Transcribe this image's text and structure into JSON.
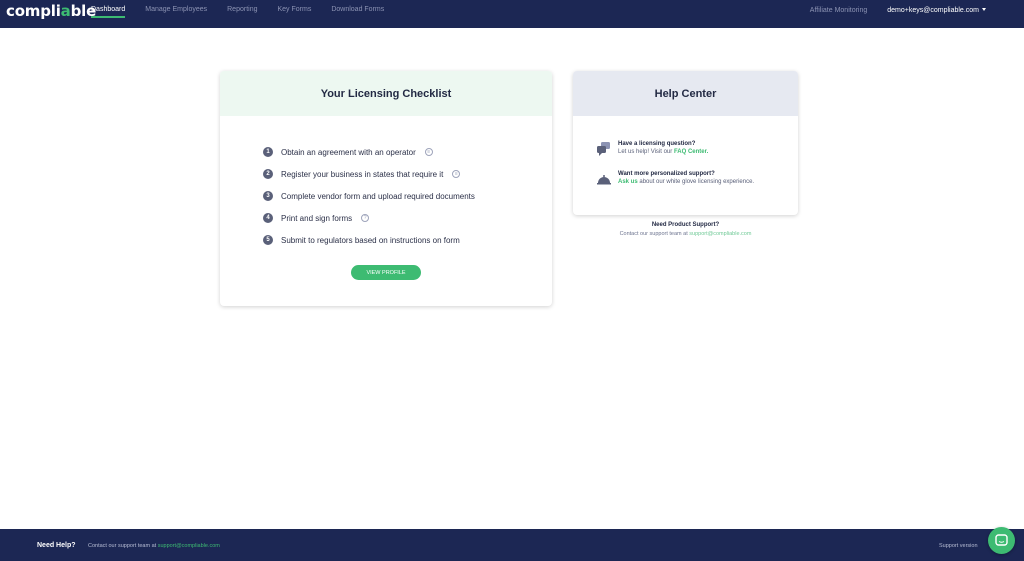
{
  "brand": {
    "name_prefix": "compli",
    "name_accent": "a",
    "name_suffix": "ble",
    "accent_color": "#3dbb72",
    "nav_color": "#1c2754"
  },
  "nav": {
    "items": [
      {
        "label": "Dashboard",
        "active": true
      },
      {
        "label": "Manage Employees",
        "active": false
      },
      {
        "label": "Reporting",
        "active": false
      },
      {
        "label": "Key Forms",
        "active": false
      },
      {
        "label": "Download Forms",
        "active": false
      }
    ],
    "affiliate": "Affiliate Monitoring",
    "user": "demo+keys@compliable.com"
  },
  "checklist": {
    "title": "Your Licensing Checklist",
    "items": [
      {
        "num": "1",
        "text": "Obtain an agreement with an operator",
        "icon": "chat-icon"
      },
      {
        "num": "2",
        "text": "Register your business in states that require it",
        "icon": "chat-icon"
      },
      {
        "num": "3",
        "text": "Complete vendor form and upload required documents",
        "icon": ""
      },
      {
        "num": "4",
        "text": "Print and sign forms",
        "icon": "help-icon"
      },
      {
        "num": "5",
        "text": "Submit to regulators based on instructions on form",
        "icon": ""
      }
    ],
    "button": "VIEW PROFILE"
  },
  "help_center": {
    "title": "Help Center",
    "q1_title": "Have a licensing question?",
    "q1_desc": "Let us help! Visit our",
    "q1_link": "FAQ Center.",
    "q2_title": "Want more personalized support?",
    "q2_link": "Ask us",
    "q2_desc": "about our white glove licensing experience."
  },
  "support": {
    "title": "Need Product Support?",
    "desc": "Contact our support team at",
    "email": "support@compliable.com"
  },
  "footer": {
    "help": "Need Help?",
    "contact": "Contact our support team at",
    "email": "support@compliable.com",
    "version": "Support version"
  }
}
